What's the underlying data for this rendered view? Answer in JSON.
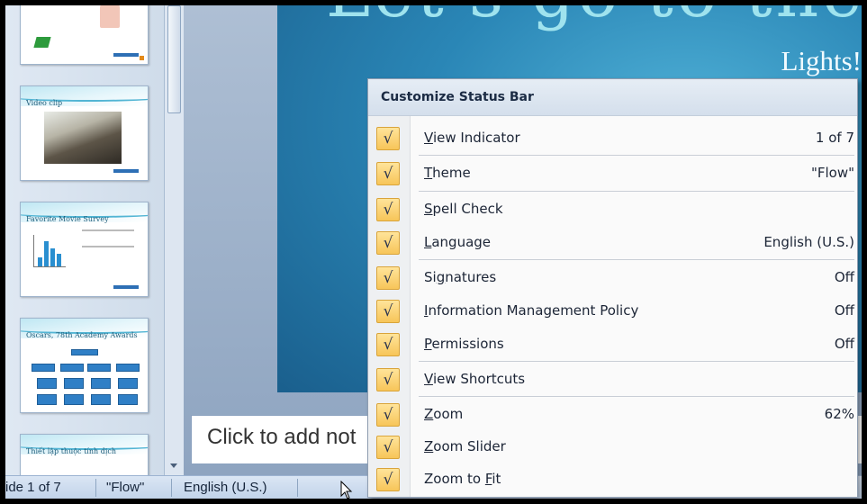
{
  "slide_preview": {
    "heading_fragment": "Let's go to the",
    "subtitle": "Lights!"
  },
  "thumbnails": [
    {
      "title": ""
    },
    {
      "title": "Video clip"
    },
    {
      "title": "Favorite Movie Survey"
    },
    {
      "title": "Oscars, 78th Academy Awards"
    },
    {
      "title": "Thiết lập thuộc tính dịch"
    }
  ],
  "notes": {
    "placeholder": "Click to add not"
  },
  "status_bar": {
    "slide_indicator": "ide 1 of 7",
    "theme": "\"Flow\"",
    "language": "English (U.S.)"
  },
  "context_menu": {
    "title": "Customize Status Bar",
    "check_color": "#f7c559",
    "check_glyph": "√",
    "items": [
      {
        "pre": "",
        "key": "V",
        "post": "iew Indicator",
        "value": "1 of 7"
      },
      {
        "pre": "",
        "key": "T",
        "post": "heme",
        "value": "\"Flow\""
      },
      {
        "pre": "",
        "key": "S",
        "post": "pell Check",
        "value": ""
      },
      {
        "pre": "",
        "key": "L",
        "post": "anguage",
        "value": "English (U.S.)"
      },
      {
        "pre": "Si",
        "key": "g",
        "post": "natures",
        "value": "Off"
      },
      {
        "pre": "",
        "key": "I",
        "post": "nformation Management Policy",
        "value": "Off"
      },
      {
        "pre": "",
        "key": "P",
        "post": "ermissions",
        "value": "Off"
      },
      {
        "pre": "",
        "key": "V",
        "post": "iew Shortcuts",
        "value": ""
      },
      {
        "pre": "",
        "key": "Z",
        "post": "oom",
        "value": "62%"
      },
      {
        "pre": "",
        "key": "Z",
        "post": "oom Slider",
        "value": ""
      },
      {
        "pre": "Zoom to ",
        "key": "F",
        "post": "it",
        "value": ""
      }
    ]
  }
}
